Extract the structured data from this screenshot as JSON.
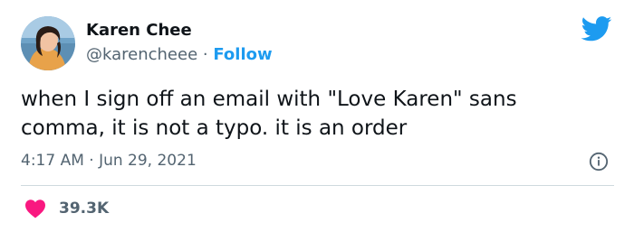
{
  "author": {
    "name": "Karen Chee",
    "handle": "@karencheee",
    "separator": "·",
    "follow_label": "Follow"
  },
  "tweet": {
    "text": "when I sign off an email with \"Love Karen\" sans\ncomma, it is not a typo. it is an order",
    "time": "4:17 AM · Jun 29, 2021"
  },
  "stats": {
    "likes": "39.3K"
  },
  "icons": {
    "brand": "twitter-bird-icon",
    "info": "info-icon",
    "like": "heart-icon"
  },
  "colors": {
    "accent": "#1d9bf0",
    "like": "#f91880",
    "muted_text": "#536471",
    "text": "#0f1419"
  }
}
